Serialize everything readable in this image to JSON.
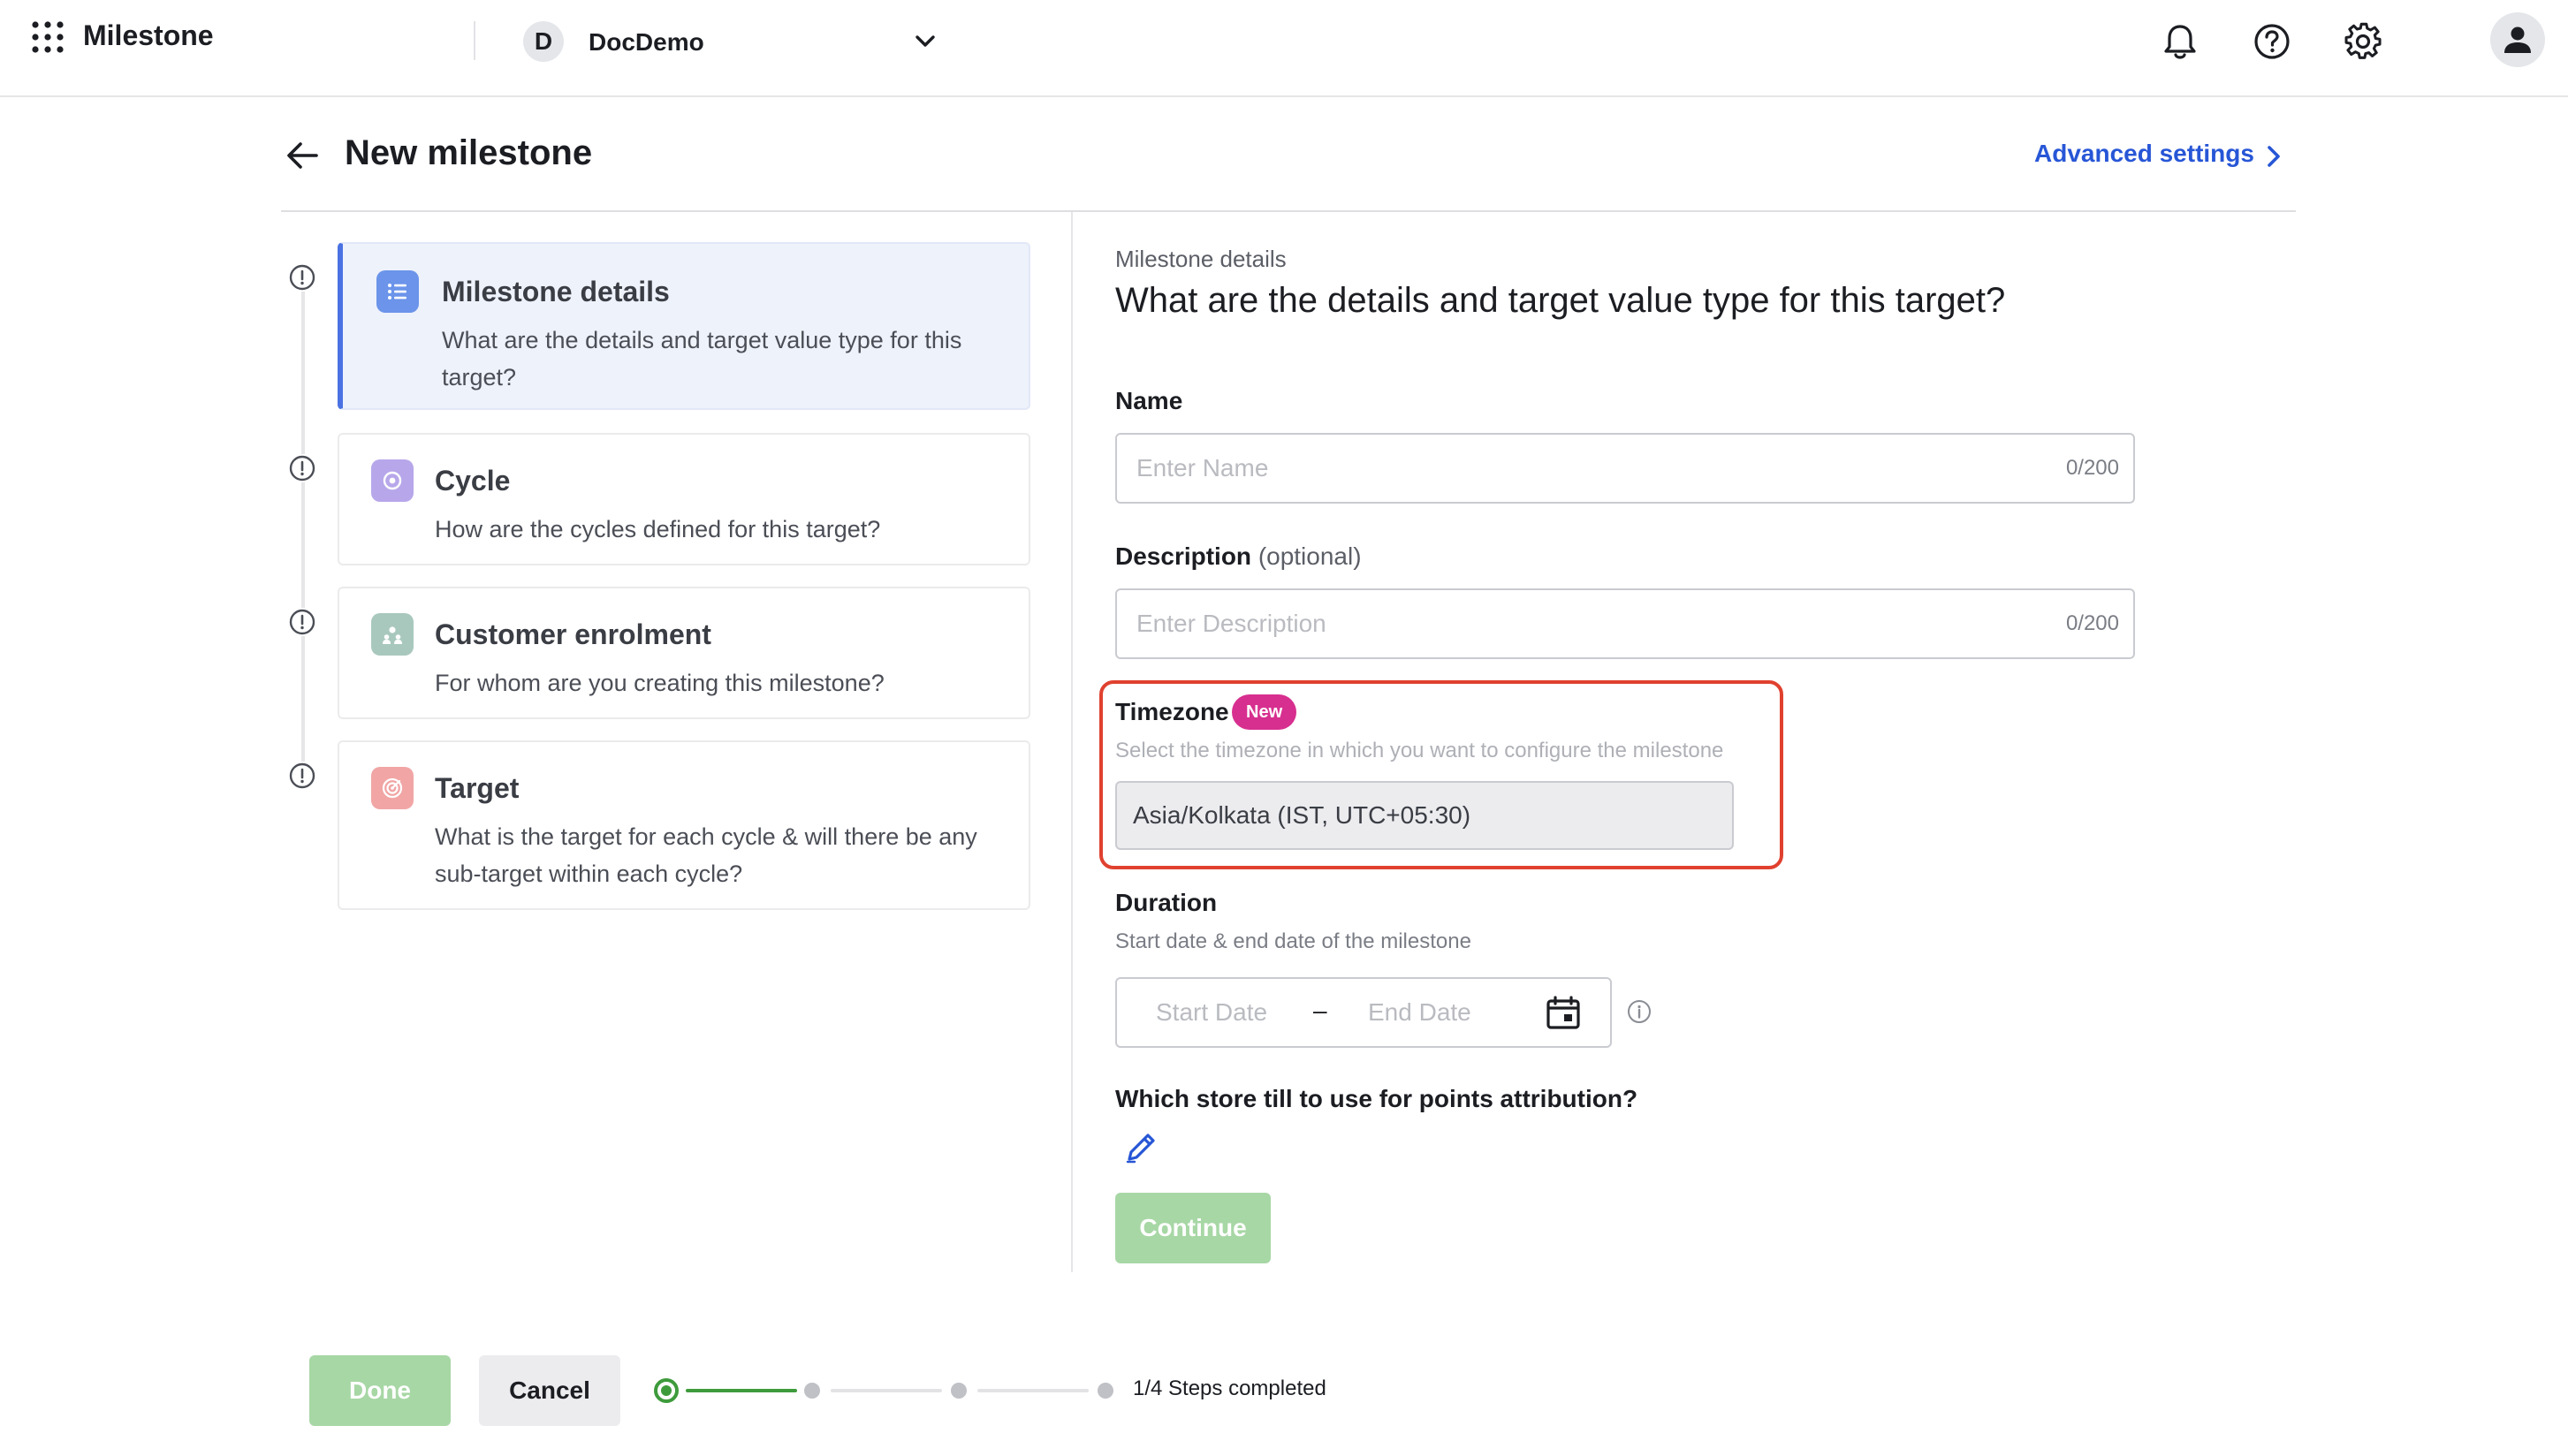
{
  "app": {
    "name": "Milestone",
    "org": {
      "initial": "D",
      "name": "DocDemo"
    }
  },
  "header": {
    "title": "New milestone",
    "advanced_link": "Advanced settings"
  },
  "stepper": {
    "steps": [
      {
        "title": "Milestone details",
        "description": "What are the details and target value type for this target?",
        "active": true,
        "badge_color": "#6b94ea"
      },
      {
        "title": "Cycle",
        "description": "How are the cycles defined for this target?",
        "active": false,
        "badge_color": "#b7a7ea"
      },
      {
        "title": "Customer enrolment",
        "description": "For whom are you creating this milestone?",
        "active": false,
        "badge_color": "#a9c8bd"
      },
      {
        "title": "Target",
        "description": "What is the target for each cycle & will there be any sub-target within each cycle?",
        "active": false,
        "badge_color": "#f1a5a5"
      }
    ]
  },
  "form": {
    "kicker": "Milestone details",
    "heading": "What are the details and target value type for this target?",
    "name": {
      "label": "Name",
      "placeholder": "Enter Name",
      "count": "0/200"
    },
    "description": {
      "label": "Description",
      "optional": "(optional)",
      "placeholder": "Enter Description",
      "count": "0/200"
    },
    "timezone": {
      "label": "Timezone",
      "badge": "New",
      "help": "Select the timezone in which you want to configure the milestone",
      "value": "Asia/Kolkata (IST, UTC+05:30)"
    },
    "duration": {
      "label": "Duration",
      "help": "Start date & end date of the milestone",
      "start_placeholder": "Start Date",
      "separator": "–",
      "end_placeholder": "End Date"
    },
    "store_question": "Which store till to use for points attribution?",
    "continue_label": "Continue"
  },
  "footer": {
    "done_label": "Done",
    "cancel_label": "Cancel",
    "steps_completed": "1/4 Steps completed",
    "completed_fraction": 0.25
  },
  "colors": {
    "accent": "#2756d6",
    "success": "#3e9b3c",
    "highlight": "#e0412f",
    "new_badge": "#d72f8f"
  }
}
